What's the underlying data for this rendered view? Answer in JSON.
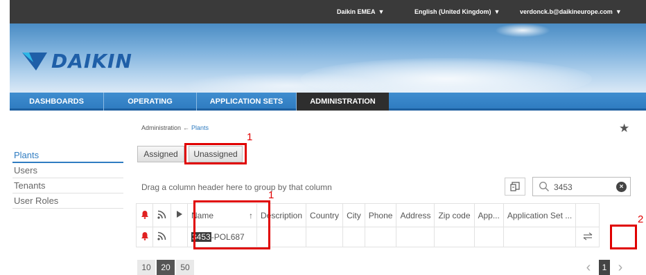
{
  "topbar": {
    "tenant": "Daikin EMEA",
    "language": "English (United Kingdom)",
    "user": "verdonck.b@daikineurope.com"
  },
  "brand": {
    "logo_text": "DAIKIN"
  },
  "main_nav": [
    {
      "label": "DASHBOARDS"
    },
    {
      "label": "OPERATING"
    },
    {
      "label": "APPLICATION SETS"
    },
    {
      "label": "ADMINISTRATION"
    }
  ],
  "sidebar": {
    "items": [
      {
        "label": "Plants"
      },
      {
        "label": "Users"
      },
      {
        "label": "Tenants"
      },
      {
        "label": "User Roles"
      }
    ]
  },
  "breadcrumb": {
    "root": "Administration",
    "current": "Plants"
  },
  "tabs": {
    "assigned": "Assigned",
    "unassigned": "Unassigned"
  },
  "grid": {
    "group_hint": "Drag a column header here to group by that column",
    "search_value": "3453",
    "columns": [
      "Name",
      "Description",
      "Country",
      "City",
      "Phone",
      "Address",
      "Zip code",
      "App...",
      "Application Set ..."
    ],
    "sort_indicator": "↑",
    "rows": [
      {
        "name_match": "3453",
        "name_rest": "-POL687"
      }
    ]
  },
  "pager": {
    "sizes": [
      "10",
      "20",
      "50"
    ],
    "active_size": "20",
    "current_page": "1"
  },
  "annotations": {
    "one": "1",
    "two": "2"
  },
  "colors": {
    "accent": "#2f7cc1",
    "nav_active": "#2e2e2e",
    "alarm": "#e02020",
    "annotation": "#e00000"
  }
}
